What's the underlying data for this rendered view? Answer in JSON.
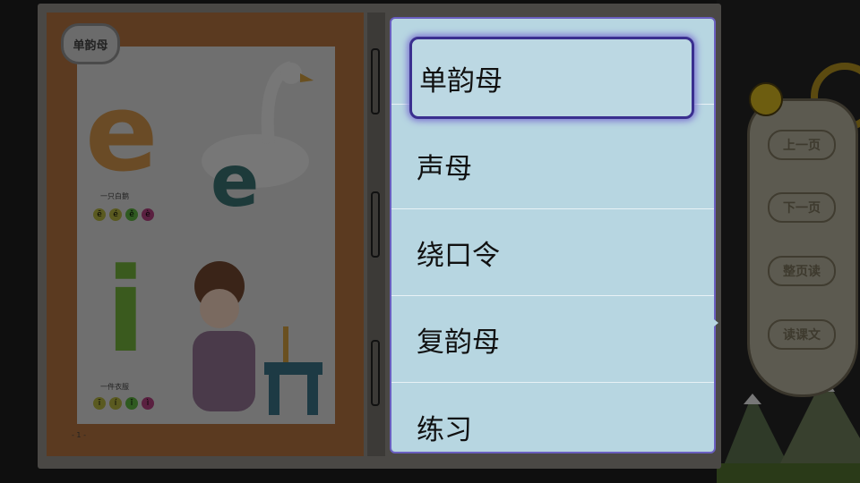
{
  "book": {
    "badge": "单韵母",
    "letter_top": "e",
    "letter_bottom": "i",
    "caption_top": "一只白鹅",
    "caption_bottom": "一件衣服",
    "tones_top": [
      "ē",
      "é",
      "ě",
      "è"
    ],
    "tones_bottom": [
      "ī",
      "í",
      "ǐ",
      "ì"
    ],
    "page_number": "- 1 -"
  },
  "menu": {
    "items": [
      {
        "label": "单韵母",
        "selected": true
      },
      {
        "label": "声母",
        "selected": false
      },
      {
        "label": "绕口令",
        "selected": false
      },
      {
        "label": "复韵母",
        "selected": false
      },
      {
        "label": "练习",
        "selected": false
      }
    ]
  },
  "side_panel": {
    "buttons": [
      "上一页",
      "下一页",
      "整页读",
      "读课文"
    ]
  }
}
